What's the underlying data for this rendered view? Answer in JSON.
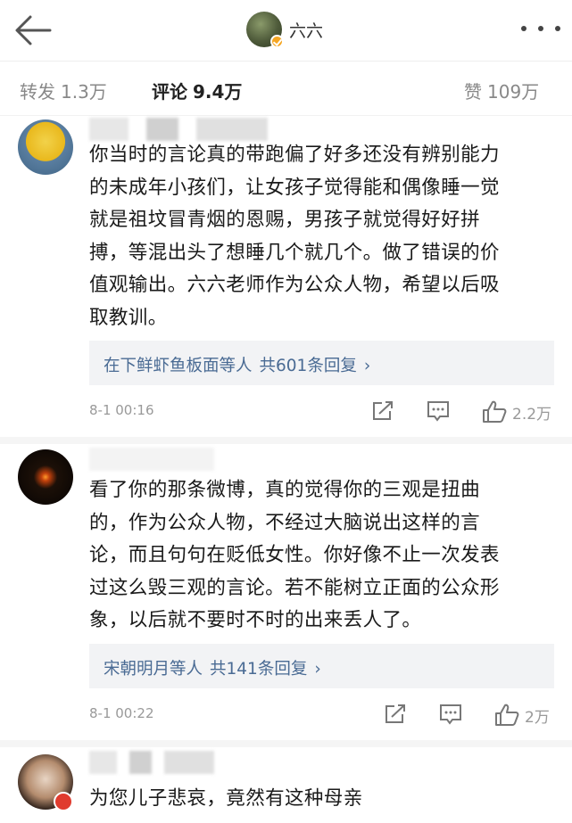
{
  "header": {
    "title": "六六",
    "back_icon": "back-arrow-icon",
    "more_icon": "more-dots-icon"
  },
  "tabs": {
    "repost": {
      "label": "转发",
      "count": "1.3万"
    },
    "comment": {
      "label": "评论",
      "count": "9.4万"
    },
    "like": {
      "label": "赞",
      "count": "109万"
    }
  },
  "comments": [
    {
      "lines": [
        "你当时的言论真的带跑偏了好多还没有辨别能力",
        "的未成年小孩们，让女孩子觉得能和偶像睡一觉",
        "就是祖坟冒青烟的恩赐，男孩子就觉得好好拼",
        "搏，等混出头了想睡几个就几个。做了错误的价",
        "值观输出。六六老师作为公众人物，希望以后吸",
        "取教训。"
      ],
      "replies": {
        "names": "在下鲜虾鱼板面等人",
        "total": "共601条回复",
        "arrow": "›"
      },
      "date": "8-1 00:16",
      "likes": "2.2万"
    },
    {
      "lines": [
        "看了你的那条微博，真的觉得你的三观是扭曲",
        "的，作为公众人物，不经过大脑说出这样的言",
        "论，而且句句在贬低女性。你好像不止一次发表",
        "过这么毁三观的言论。若不能树立正面的公众形",
        "象，以后就不要时不时的出来丢人了。"
      ],
      "replies": {
        "names": "宋朝明月等人",
        "total": "共141条回复",
        "arrow": "›"
      },
      "date": "8-1 00:22",
      "likes": "2万"
    },
    {
      "lines": [
        "为您儿子悲哀，竟然有这种母亲"
      ]
    }
  ],
  "icons": [
    "share-icon",
    "comment-icon",
    "like-icon"
  ],
  "colors": {
    "link": "#4a6b94",
    "meta": "#999999",
    "verified": "#f5a623"
  }
}
